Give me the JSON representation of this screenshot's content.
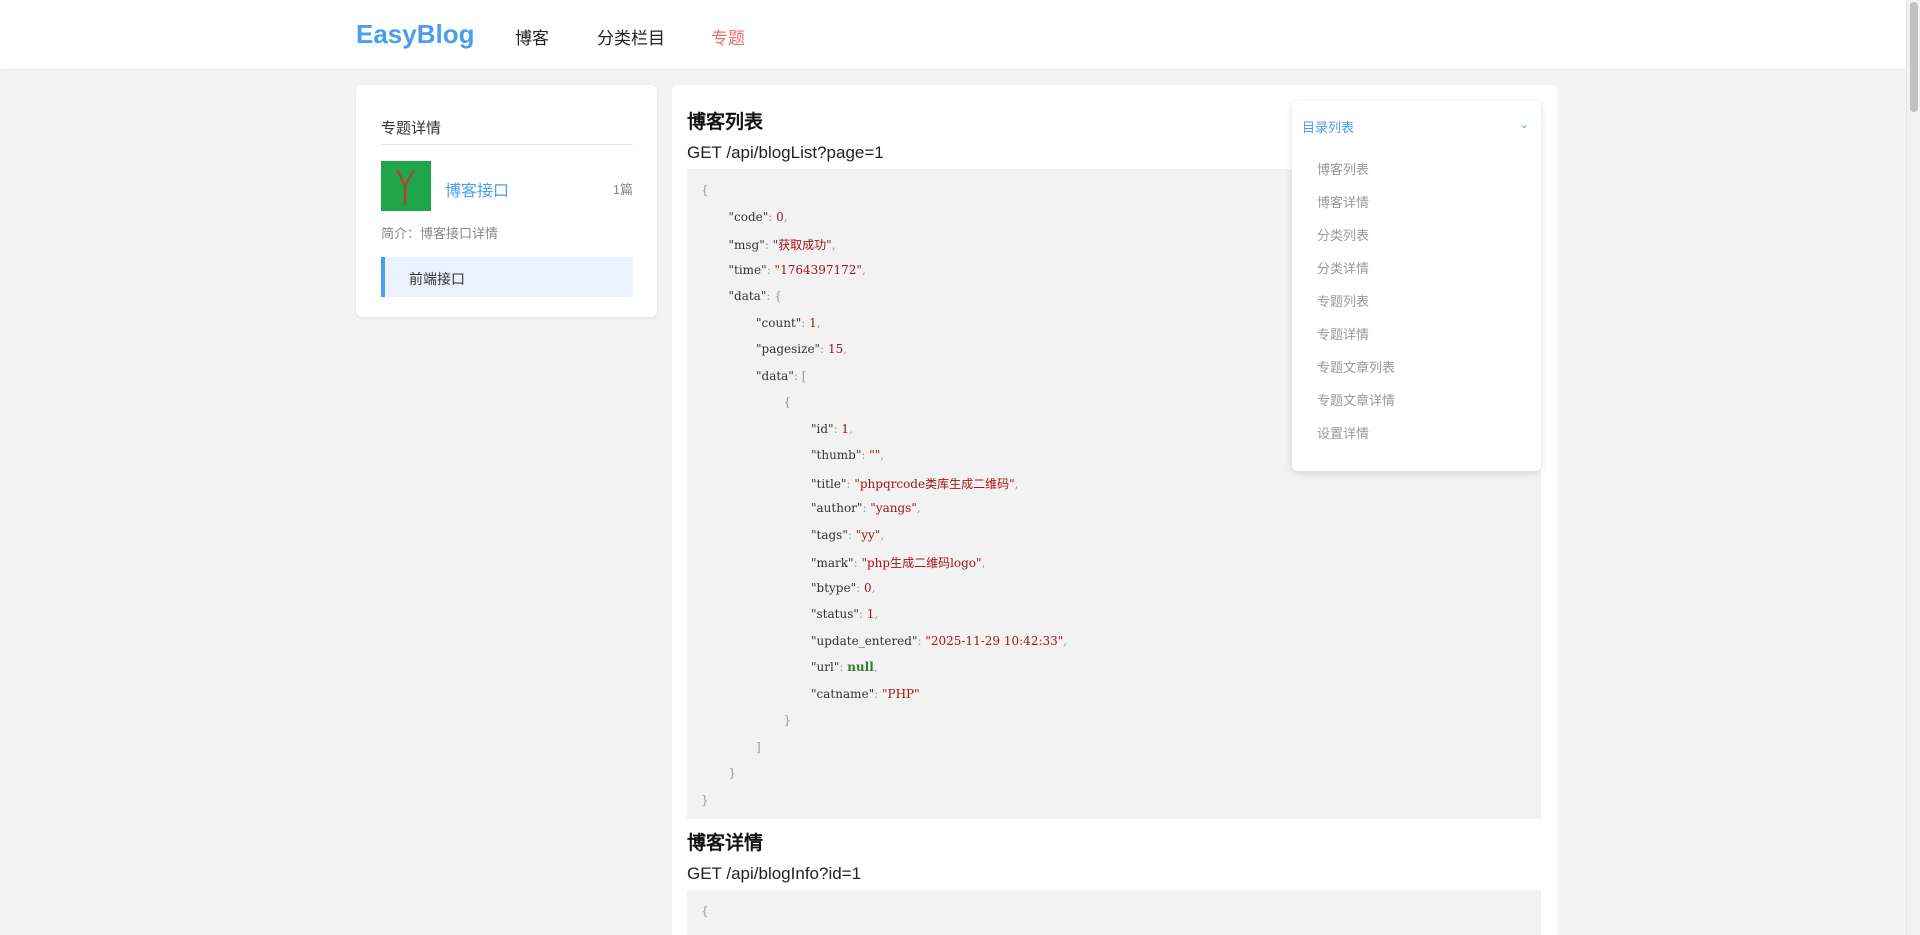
{
  "header": {
    "logo": "EasyBlog",
    "nav": [
      {
        "label": "博客"
      },
      {
        "label": "分类栏目"
      },
      {
        "label": "专题"
      }
    ]
  },
  "sidebar": {
    "title": "专题详情",
    "topic": {
      "name": "博客接口",
      "count": "1篇",
      "desc": "简介：博客接口详情"
    },
    "items": [
      {
        "label": "前端接口"
      }
    ]
  },
  "sections": [
    {
      "title": "博客列表",
      "url": "GET /api/blogList?page=1",
      "code_lines": [
        "{",
        "\"code\": 0,",
        "\"msg\": \"获取成功\",",
        "\"time\": \"1764397172\",",
        "\"data\": {",
        "\"count\": 1,",
        "\"pagesize\": 15,",
        "\"data\": [",
        "{",
        "\"id\": 1,",
        "\"thumb\": \"\",",
        "\"title\": \"phpqrcode类库生成二维码\",",
        "\"author\": \"yangs\",",
        "\"tags\": \"yy\",",
        "\"mark\": \"php生成二维码logo\",",
        "\"btype\": 0,",
        "\"status\": 1,",
        "\"update_entered\": \"2025-11-29 10:42:33\",",
        "\"url\": null,",
        "\"catname\": \"PHP\"",
        "}",
        "]",
        "}",
        "}"
      ]
    },
    {
      "title": "博客详情",
      "url": "GET /api/blogInfo?id=1",
      "code_lines": [
        "{"
      ]
    }
  ],
  "toc": {
    "title": "目录列表",
    "items": [
      "博客列表",
      "博客详情",
      "分类列表",
      "分类详情",
      "专题列表",
      "专题详情",
      "专题文章列表",
      "专题文章详情",
      "设置详情"
    ]
  },
  "colors": {
    "accent": "#4a9ef0",
    "active_nav": "#f56c6c",
    "string": "#a31515",
    "keyword": "#2e7d32"
  }
}
